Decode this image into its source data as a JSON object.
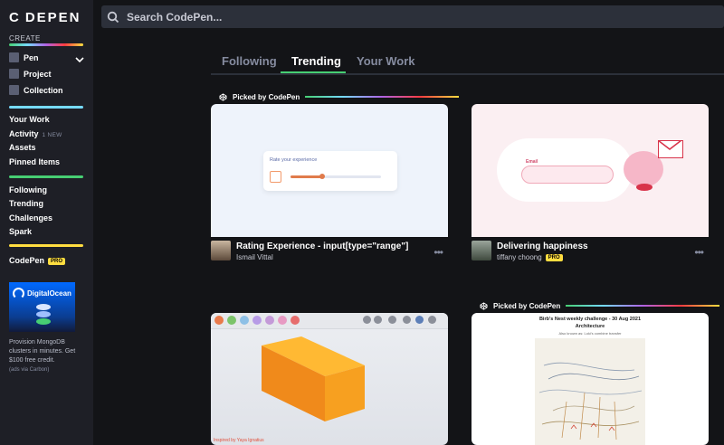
{
  "sidebar": {
    "logo": "C DEPEN",
    "create_label": "CREATE",
    "create_items": [
      {
        "label": "Pen"
      },
      {
        "label": "Project"
      },
      {
        "label": "Collection"
      }
    ],
    "primary_links": [
      "Your Work",
      "Activity",
      "Assets",
      "Pinned Items"
    ],
    "activity_badge": "1 NEW",
    "secondary_links": [
      "Following",
      "Trending",
      "Challenges",
      "Spark"
    ],
    "pro_label": "CodePen",
    "pro_badge": "PRO",
    "ad": {
      "brand": "DigitalOcean",
      "text": "Provision MongoDB clusters in minutes. Get $100 free credit.",
      "via": "(ads via Carbon)"
    }
  },
  "search": {
    "placeholder": "Search CodePen..."
  },
  "tabs": [
    {
      "label": "Following",
      "active": false
    },
    {
      "label": "Trending",
      "active": true
    },
    {
      "label": "Your Work",
      "active": false
    }
  ],
  "picked_label": "Picked by CodePen",
  "cards": [
    {
      "title": "Rating Experience - input[type=\"range\"]",
      "author": "Ismail Vittal",
      "preview_heading": "Rate your experience",
      "rating": 0.35
    },
    {
      "title": "Delivering happiness",
      "author": "tiffany choong",
      "author_badge": "PRO",
      "preview_field": "Email"
    },
    {
      "preview_footer": "Inspired by Yaya Ignatius"
    },
    {
      "preview_heading": "Birb's Nest weekly challenge - 30 Aug 2021",
      "preview_subheading": "Architecture",
      "preview_caption": "Also known as: Loki's combine transfer"
    }
  ],
  "colors": {
    "accent_green": "#47cf73",
    "pro_yellow": "#ffdd40",
    "bg": "#131417",
    "sidebar": "#1e1f26"
  }
}
